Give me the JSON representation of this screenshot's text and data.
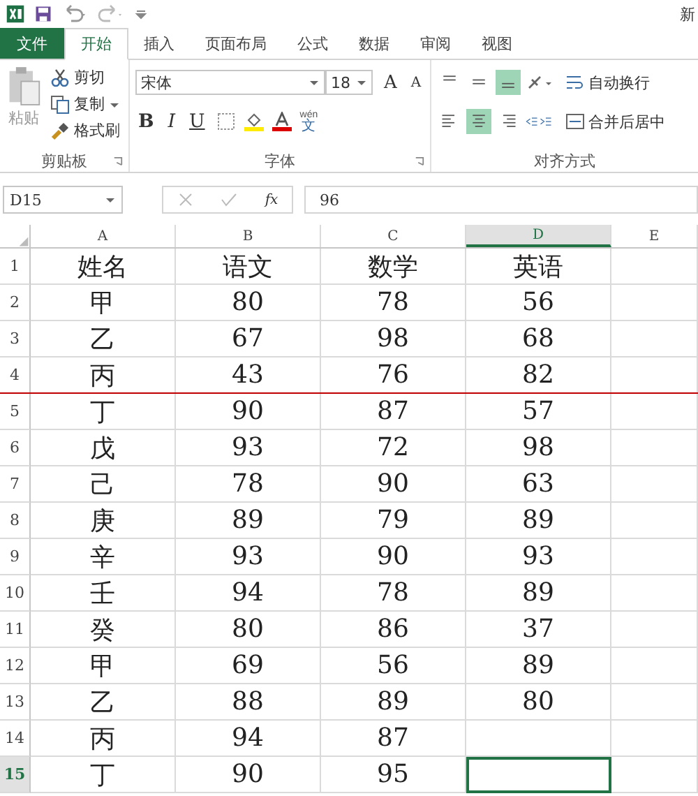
{
  "title": "新",
  "tabs": [
    {
      "label": "文件",
      "kind": "file",
      "selected": false
    },
    {
      "label": "开始",
      "kind": "tab",
      "selected": true
    },
    {
      "label": "插入",
      "kind": "tab",
      "selected": false
    },
    {
      "label": "页面布局",
      "kind": "tab",
      "selected": false
    },
    {
      "label": "公式",
      "kind": "tab",
      "selected": false
    },
    {
      "label": "数据",
      "kind": "tab",
      "selected": false
    },
    {
      "label": "审阅",
      "kind": "tab",
      "selected": false
    },
    {
      "label": "视图",
      "kind": "tab",
      "selected": false
    }
  ],
  "clipboard": {
    "paste": "粘贴",
    "cut": "剪切",
    "copy": "复制",
    "format_painter": "格式刷",
    "label": "剪贴板"
  },
  "font": {
    "name": "宋体",
    "size": "18",
    "grow": "A",
    "shrink": "A",
    "bold": "B",
    "italic": "I",
    "underline": "U",
    "phonetic_top": "wén",
    "phonetic_bottom": "文",
    "label": "字体"
  },
  "alignment": {
    "vertical": [
      {
        "kind": "top",
        "selected": false
      },
      {
        "kind": "middle",
        "selected": false
      },
      {
        "kind": "bottom",
        "selected": true
      }
    ],
    "horizontal": [
      {
        "kind": "left",
        "selected": false
      },
      {
        "kind": "center",
        "selected": true
      },
      {
        "kind": "right",
        "selected": false
      }
    ],
    "wrap": "自动换行",
    "merge": "合并后居中",
    "label": "对齐方式"
  },
  "formula_bar": {
    "name_box": "D15",
    "fx": "fx",
    "value": "96"
  },
  "columns": [
    {
      "label": "A",
      "selected": false
    },
    {
      "label": "B",
      "selected": false
    },
    {
      "label": "C",
      "selected": false
    },
    {
      "label": "D",
      "selected": true
    },
    {
      "label": "E",
      "selected": false
    }
  ],
  "rows": [
    {
      "number": "1",
      "selected": false,
      "page_break_below": false,
      "cells": [
        "姓名",
        "语文",
        "数学",
        "英语"
      ]
    },
    {
      "number": "2",
      "selected": false,
      "page_break_below": false,
      "cells": [
        "甲",
        "80",
        "78",
        "56"
      ]
    },
    {
      "number": "3",
      "selected": false,
      "page_break_below": false,
      "cells": [
        "乙",
        "67",
        "98",
        "68"
      ]
    },
    {
      "number": "4",
      "selected": false,
      "page_break_below": true,
      "cells": [
        "丙",
        "43",
        "76",
        "82"
      ]
    },
    {
      "number": "5",
      "selected": false,
      "page_break_below": false,
      "cells": [
        "丁",
        "90",
        "87",
        "57"
      ]
    },
    {
      "number": "6",
      "selected": false,
      "page_break_below": false,
      "cells": [
        "戊",
        "93",
        "72",
        "98"
      ]
    },
    {
      "number": "7",
      "selected": false,
      "page_break_below": false,
      "cells": [
        "己",
        "78",
        "90",
        "63"
      ]
    },
    {
      "number": "8",
      "selected": false,
      "page_break_below": false,
      "cells": [
        "庚",
        "89",
        "79",
        "89"
      ]
    },
    {
      "number": "9",
      "selected": false,
      "page_break_below": false,
      "cells": [
        "辛",
        "93",
        "90",
        "93"
      ]
    },
    {
      "number": "10",
      "selected": false,
      "page_break_below": false,
      "cells": [
        "壬",
        "94",
        "78",
        "89"
      ]
    },
    {
      "number": "11",
      "selected": false,
      "page_break_below": false,
      "cells": [
        "癸",
        "80",
        "86",
        "37"
      ]
    },
    {
      "number": "12",
      "selected": false,
      "page_break_below": false,
      "cells": [
        "甲",
        "69",
        "56",
        "89"
      ]
    },
    {
      "number": "13",
      "selected": false,
      "page_break_below": false,
      "cells": [
        "乙",
        "88",
        "89",
        "80"
      ]
    },
    {
      "number": "14",
      "selected": false,
      "page_break_below": false,
      "cells": [
        "丙",
        "94",
        "87"
      ]
    },
    {
      "number": "15",
      "selected": true,
      "page_break_below": false,
      "cells": [
        "丁",
        "90",
        "95"
      ]
    }
  ]
}
